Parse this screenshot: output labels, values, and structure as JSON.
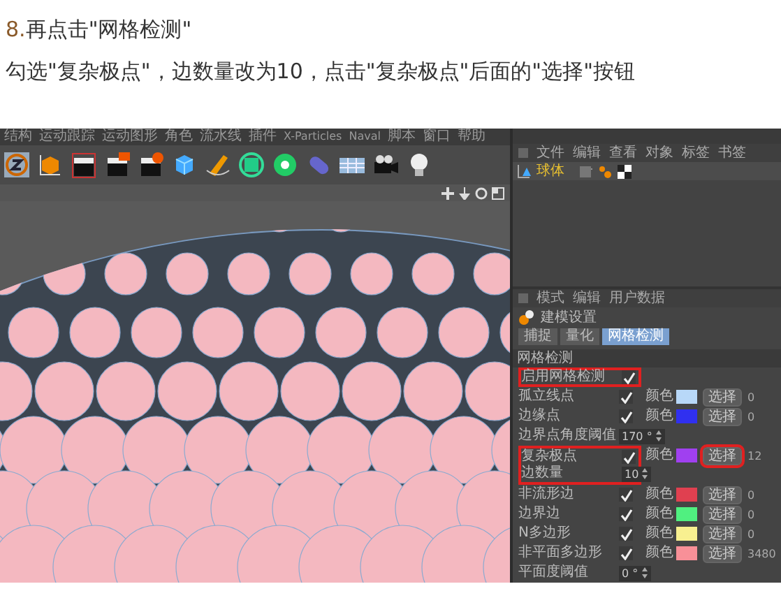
{
  "instruction": {
    "step_number": "8.",
    "step_text": "再点击\"网格检测\"",
    "detail": "勾选\"复杂极点\"，边数量改为10，点击\"复杂极点\"后面的\"选择\"按钮"
  },
  "app": {
    "menu": [
      "结构",
      "运动跟踪",
      "运动图形",
      "角色",
      "流水线",
      "插件",
      "X-Particles",
      "Naval",
      "脚本",
      "窗口",
      "帮助"
    ],
    "object_menu": [
      "文件",
      "编辑",
      "查看",
      "对象",
      "标签",
      "书签"
    ],
    "objects": [
      {
        "name": "球体"
      }
    ],
    "attribute_menu": [
      "模式",
      "编辑",
      "用户数据"
    ],
    "attribute_title": "建模设置",
    "tabs": [
      {
        "label": "捕捉",
        "selected": false
      },
      {
        "label": "量化",
        "selected": false
      },
      {
        "label": "网格检测",
        "selected": true
      }
    ],
    "section": "网格检测",
    "settings": [
      {
        "kind": "check",
        "label": "启用网格检测",
        "checked": true,
        "highlighted": true
      },
      {
        "kind": "check",
        "label": "孤立线点",
        "checked": true,
        "highlighted": false,
        "color_label": "颜色",
        "color": "#b8d8f8",
        "button": "选择",
        "button_highlighted": false,
        "count": "0"
      },
      {
        "kind": "check",
        "label": "边缘点",
        "checked": true,
        "highlighted": false,
        "color_label": "颜色",
        "color": "#3030f0",
        "button": "选择",
        "button_highlighted": false,
        "count": "0"
      },
      {
        "kind": "value",
        "label": "边界点角度阈值",
        "value": "170 °",
        "highlighted": false
      },
      {
        "kind": "check",
        "label": "复杂极点",
        "checked": true,
        "highlighted": true,
        "color_label": "颜色",
        "color": "#a040f0",
        "button": "选择",
        "button_highlighted": true,
        "count": "12"
      },
      {
        "kind": "value",
        "label": "边数量",
        "value": "10",
        "highlighted": true
      },
      {
        "kind": "check",
        "label": "非流形边",
        "checked": true,
        "highlighted": false,
        "color_label": "颜色",
        "color": "#e04050",
        "button": "选择",
        "button_highlighted": false,
        "count": "0"
      },
      {
        "kind": "check",
        "label": "边界边",
        "checked": true,
        "highlighted": false,
        "color_label": "颜色",
        "color": "#50f080",
        "button": "选择",
        "button_highlighted": false,
        "count": "0"
      },
      {
        "kind": "check",
        "label": "N多边形",
        "checked": true,
        "highlighted": false,
        "color_label": "颜色",
        "color": "#f8f090",
        "button": "选择",
        "button_highlighted": false,
        "count": "0"
      },
      {
        "kind": "check",
        "label": "非平面多边形",
        "checked": true,
        "highlighted": false,
        "color_label": "颜色",
        "color": "#f89098",
        "button": "选择",
        "button_highlighted": false,
        "count": "3480"
      },
      {
        "kind": "value",
        "label": "平面度阈值",
        "value": "0 °",
        "highlighted": false
      }
    ]
  }
}
